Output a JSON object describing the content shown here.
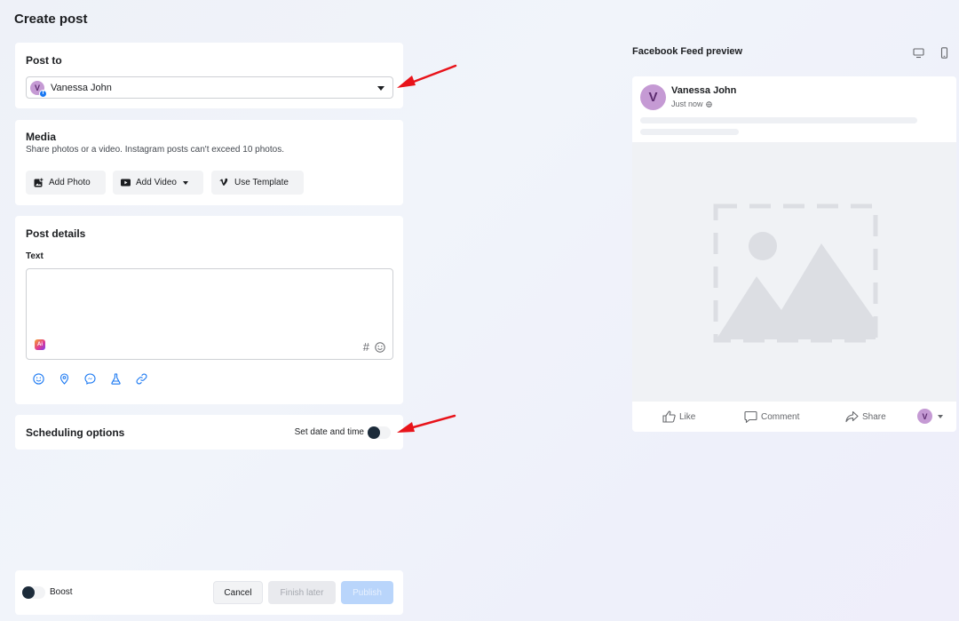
{
  "page": {
    "title": "Create post"
  },
  "post_to": {
    "title": "Post to",
    "account": {
      "name": "Vanessa John",
      "initial": "V"
    }
  },
  "media": {
    "title": "Media",
    "subtitle": "Share photos or a video. Instagram posts can't exceed 10 photos.",
    "add_photo_label": "Add Photo",
    "add_video_label": "Add Video",
    "use_template_label": "Use Template"
  },
  "post_details": {
    "title": "Post details",
    "text_label": "Text",
    "text_value": "",
    "ai_badge": "Ai",
    "hash_glyph": "#"
  },
  "scheduling": {
    "title": "Scheduling options",
    "toggle_label": "Set date and time",
    "enabled": false
  },
  "footer": {
    "boost_label": "Boost",
    "boost_enabled": false,
    "cancel_label": "Cancel",
    "finish_later_label": "Finish later",
    "publish_label": "Publish"
  },
  "preview": {
    "title": "Facebook Feed preview",
    "account_name": "Vanessa John",
    "initial": "V",
    "time": "Just now",
    "like_label": "Like",
    "comment_label": "Comment",
    "share_label": "Share"
  },
  "colors": {
    "accent": "#1877f2",
    "avatar": "#c59ad4",
    "arrow": "#e8131a",
    "publish_disabled": "#b9d5fb"
  },
  "icons": {
    "media": [
      "add-photo-icon",
      "video-icon",
      "vimeo-icon"
    ],
    "tools": [
      "emoji-icon",
      "location-icon",
      "messenger-icon",
      "flask-icon",
      "link-icon"
    ],
    "device": [
      "desktop-icon",
      "mobile-icon"
    ]
  }
}
